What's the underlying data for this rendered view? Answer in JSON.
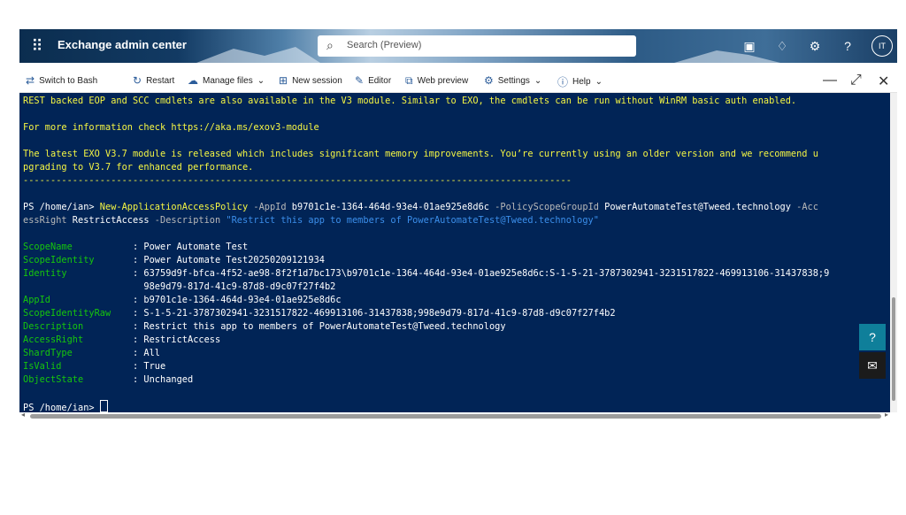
{
  "header": {
    "app_title": "Exchange admin center",
    "search_placeholder": "Search (Preview)",
    "avatar_initials": "IT"
  },
  "toolbar": {
    "switch_bash": "Switch to Bash",
    "restart": "Restart",
    "manage_files": "Manage files",
    "new_session": "New session",
    "editor": "Editor",
    "web_preview": "Web preview",
    "settings": "Settings",
    "help": "Help"
  },
  "terminal": {
    "l1": "REST backed EOP and SCC cmdlets are also available in the V3 module. Similar to EXO, the cmdlets can be run without WinRM basic auth enabled.",
    "l2": "For more information check https://aka.ms/exov3-module",
    "l3": "The latest EXO V3.7 module is released which includes significant memory improvements. You’re currently using an older version and we recommend u",
    "l4": "pgrading to V3.7 for enhanced performance.",
    "divider": "----------------------------------------------------------------------------------------------------",
    "cmd": {
      "prompt": "PS /home/ian> ",
      "cmdlet": "New-ApplicationAccessPolicy",
      "p1": " -AppId ",
      "v1": "b9701c1e-1364-464d-93e4-01ae925e8d6c",
      "p2": " -PolicyScopeGroupId ",
      "v2": "PowerAutomateTest@Tweed.technology",
      "p3a": " -Acc",
      "p3b": "essRight ",
      "v3": "RestrictAccess",
      "p4": " -Description ",
      "v4": "\"Restrict this app to members of PowerAutomateTest@Tweed.technology\""
    },
    "output": [
      {
        "key": "ScopeName",
        "value": "Power Automate Test"
      },
      {
        "key": "ScopeIdentity",
        "value": "Power Automate Test20250209121934"
      },
      {
        "key": "Identity",
        "value": "63759d9f-bfca-4f52-ae98-8f2f1d7bc173\\b9701c1e-1364-464d-93e4-01ae925e8d6c:S-1-5-21-3787302941-3231517822-469913106-31437838;9"
      },
      {
        "key": "",
        "value": "98e9d79-817d-41c9-87d8-d9c07f27f4b2"
      },
      {
        "key": "AppId",
        "value": "b9701c1e-1364-464d-93e4-01ae925e8d6c"
      },
      {
        "key": "ScopeIdentityRaw",
        "value": "S-1-5-21-3787302941-3231517822-469913106-31437838;998e9d79-817d-41c9-87d8-d9c07f27f4b2"
      },
      {
        "key": "Description",
        "value": "Restrict this app to members of PowerAutomateTest@Tweed.technology"
      },
      {
        "key": "AccessRight",
        "value": "RestrictAccess"
      },
      {
        "key": "ShardType",
        "value": "All"
      },
      {
        "key": "IsValid",
        "value": "True"
      },
      {
        "key": "ObjectState",
        "value": "Unchanged"
      }
    ],
    "final_prompt": "PS /home/ian> "
  }
}
